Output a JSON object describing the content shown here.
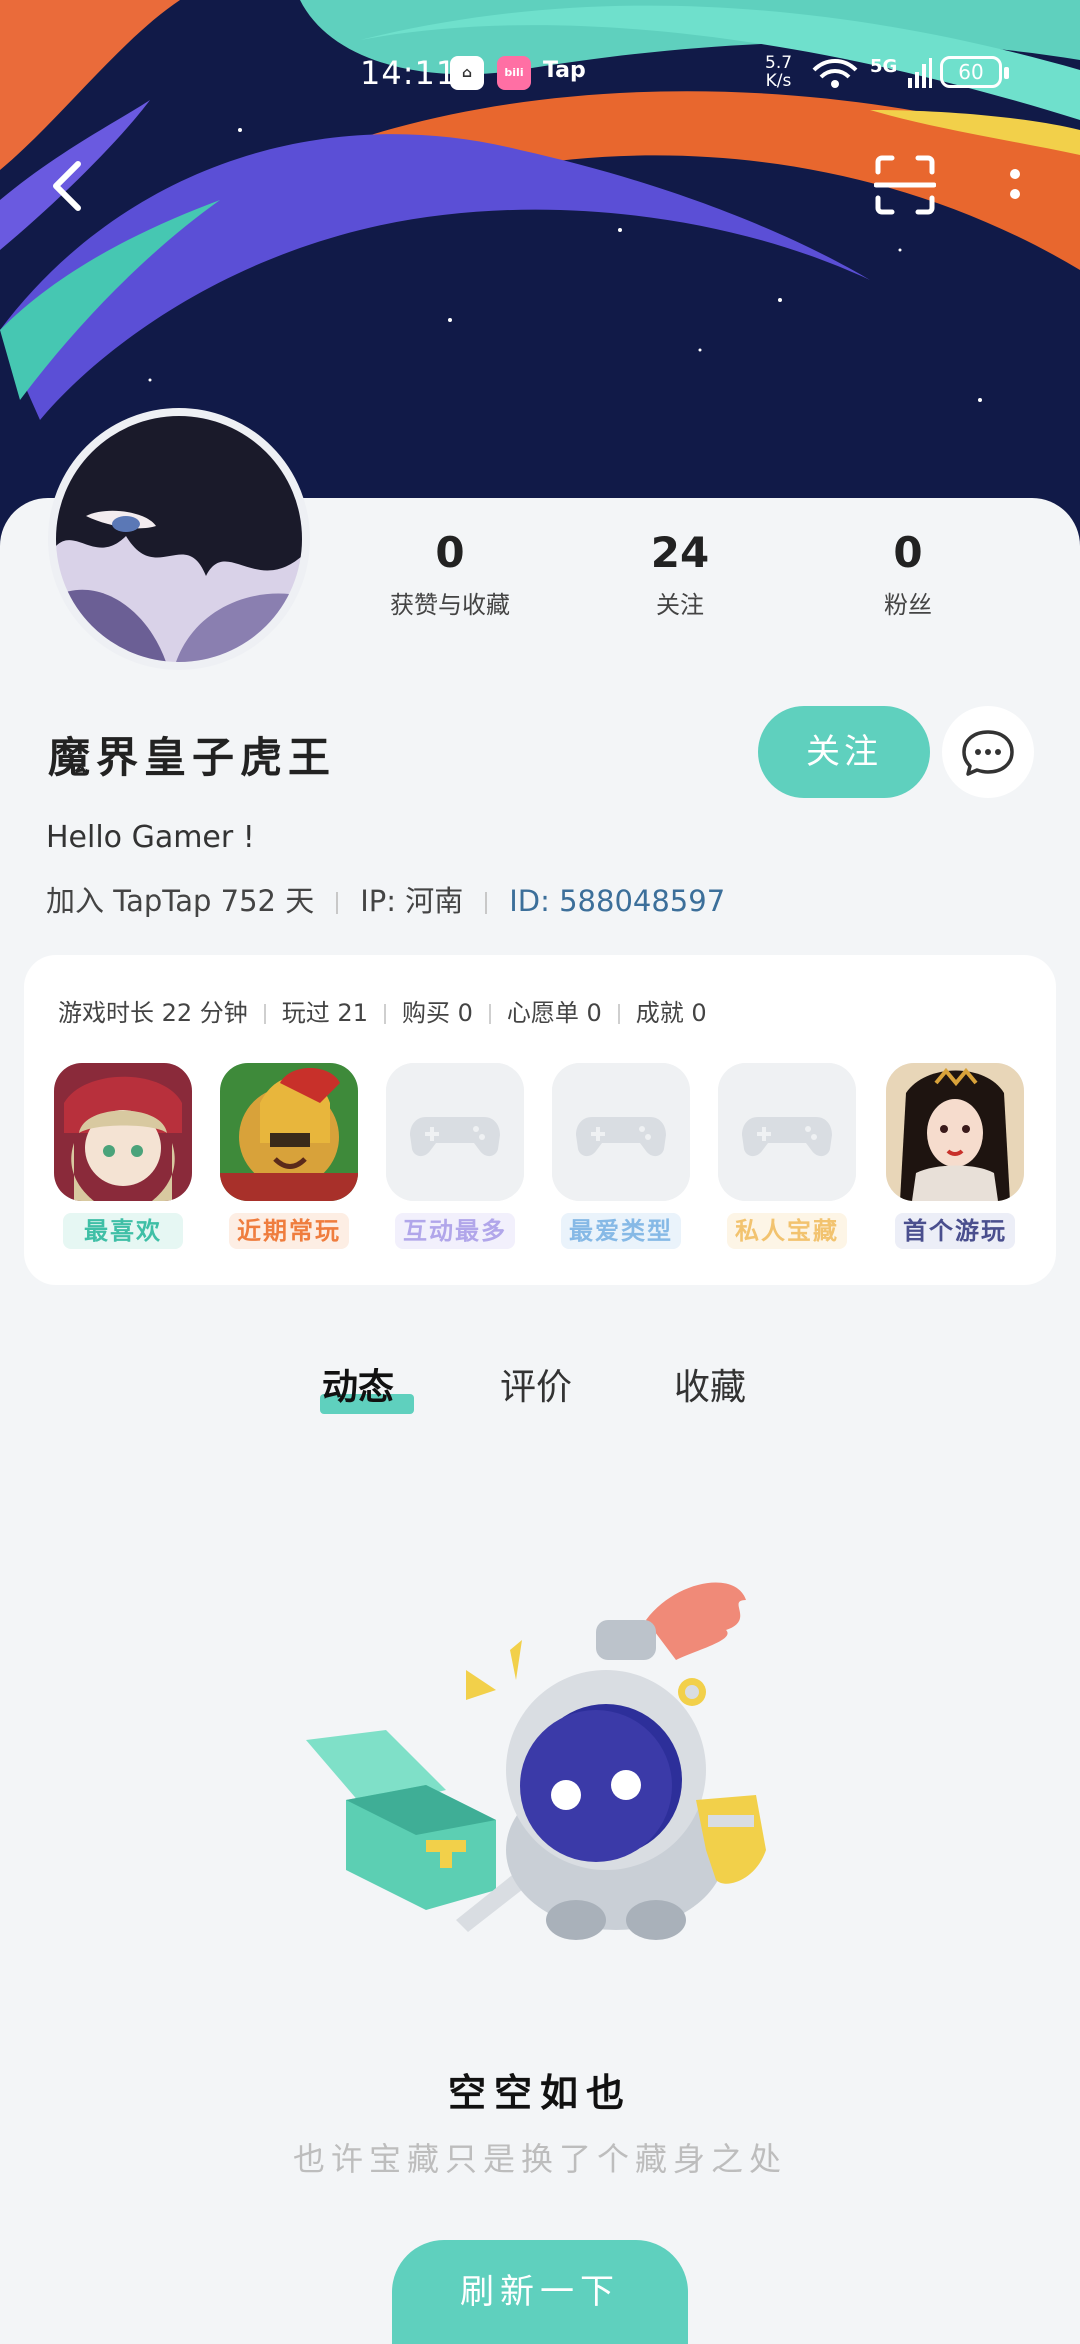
{
  "status_bar": {
    "time": "14:11",
    "app_icons": [
      "kaiyan-icon",
      "bilibili-icon"
    ],
    "tap_label": "Tap",
    "net_speed_value": "5.7",
    "net_speed_unit": "K/s",
    "network_label": "5G",
    "battery": "60"
  },
  "profile": {
    "stats": [
      {
        "value": "0",
        "label": "获赞与收藏"
      },
      {
        "value": "24",
        "label": "关注"
      },
      {
        "value": "0",
        "label": "粉丝"
      }
    ],
    "username": "魔界皇子虎王",
    "follow_label": "关注",
    "bio": "Hello Gamer !",
    "joined": "加入 TapTap 752 天",
    "ip": "IP: 河南",
    "id": "ID: 588048597"
  },
  "game_card": {
    "stats": [
      "游戏时长 22 分钟",
      "玩过 21",
      "购买 0",
      "心愿单 0",
      "成就 0"
    ],
    "tiles": [
      {
        "label": "最喜欢",
        "color": "#3fbfa6",
        "bg": "#e6f7f3",
        "icon": "girl-character-icon"
      },
      {
        "label": "近期常玩",
        "color": "#ef7d3e",
        "bg": "#fdeee4",
        "icon": "spartan-warrior-icon"
      },
      {
        "label": "互动最多",
        "color": "#b1a6ea",
        "bg": "#f2f0fc",
        "icon": "gamepad-placeholder-icon"
      },
      {
        "label": "最爱类型",
        "color": "#86b9e6",
        "bg": "#eaf3fb",
        "icon": "gamepad-placeholder-icon"
      },
      {
        "label": "私人宝藏",
        "color": "#f2c36f",
        "bg": "#fdf5e6",
        "icon": "gamepad-placeholder-icon"
      },
      {
        "label": "首个游玩",
        "color": "#4a4f8e",
        "bg": "#eceef7",
        "icon": "xianxia-woman-icon"
      }
    ]
  },
  "tabs": [
    {
      "label": "动态",
      "active": true
    },
    {
      "label": "评价",
      "active": false
    },
    {
      "label": "收藏",
      "active": false
    }
  ],
  "empty_state": {
    "title": "空空如也",
    "subtitle": "也许宝藏只是换了个藏身之处",
    "refresh_label": "刷新一下"
  },
  "colors": {
    "accent": "#5fd0be",
    "background": "#f3f5f7",
    "header_navy": "#111a48"
  }
}
